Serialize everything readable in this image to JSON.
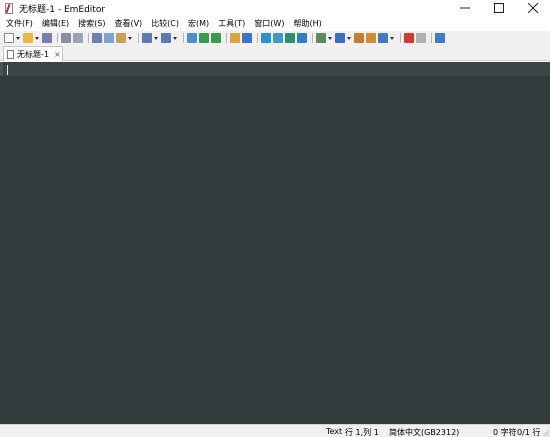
{
  "window": {
    "title": "无标题-1 - EmEditor",
    "minimize_icon": "minimize-icon",
    "maximize_icon": "maximize-icon",
    "close_icon": "close-icon"
  },
  "menu": {
    "items": [
      {
        "label": "文件(F)"
      },
      {
        "label": "编辑(E)"
      },
      {
        "label": "搜索(S)"
      },
      {
        "label": "查看(V)"
      },
      {
        "label": "比较(C)"
      },
      {
        "label": "宏(M)"
      },
      {
        "label": "工具(T)"
      },
      {
        "label": "窗口(W)"
      },
      {
        "label": "帮助(H)"
      }
    ]
  },
  "toolbar": {
    "buttons": [
      {
        "icon": "new-file-icon",
        "color": "#ffffff"
      },
      {
        "icon": "open-file-icon",
        "color": "#e8b73c"
      },
      {
        "icon": "save-icon",
        "color": "#7b7ea8"
      },
      {
        "icon": "print-icon",
        "color": "#8a8fa0"
      },
      {
        "icon": "print-preview-icon",
        "color": "#9aa4b8"
      },
      {
        "icon": "cut-icon",
        "color": "#6a7fb5"
      },
      {
        "icon": "copy-icon",
        "color": "#7fa0d4"
      },
      {
        "icon": "paste-icon",
        "color": "#c9a255"
      },
      {
        "icon": "undo-icon",
        "color": "#5c7ab8"
      },
      {
        "icon": "redo-icon",
        "color": "#5c7ab8"
      },
      {
        "icon": "find-icon",
        "color": "#4a8fd0"
      },
      {
        "icon": "find-next-icon",
        "color": "#3c9a4b"
      },
      {
        "icon": "find-previous-icon",
        "color": "#3c9a4b"
      },
      {
        "icon": "find-in-files-icon",
        "color": "#d9a53a"
      },
      {
        "icon": "format-icon",
        "color": "#3a73c9"
      },
      {
        "icon": "layout-icon",
        "color": "#2d8fd5"
      },
      {
        "icon": "split-horizontal-icon",
        "color": "#3d9acb"
      },
      {
        "icon": "split-vertical-icon",
        "color": "#2d8f6d"
      },
      {
        "icon": "outline-icon",
        "color": "#2f7fc2"
      },
      {
        "icon": "document-icon",
        "color": "#5b8c5a"
      },
      {
        "icon": "compare-icon",
        "color": "#3a6dc4"
      },
      {
        "icon": "settings-icon",
        "color": "#c87a2e"
      },
      {
        "icon": "edit-icon",
        "color": "#d28b2d"
      },
      {
        "icon": "window-icon",
        "color": "#3f7ac6"
      },
      {
        "icon": "record-macro-icon",
        "color": "#d33a2f"
      },
      {
        "icon": "run-macro-icon",
        "color": "#9a9a9a"
      },
      {
        "icon": "plugin-icon",
        "color": "#3f7ac6"
      }
    ]
  },
  "tabs": [
    {
      "label": "无标题-1",
      "close": "×"
    }
  ],
  "editor": {
    "background": "#323a3c",
    "current_line_background": "#3d4446",
    "caret_color": "#d7e3ff"
  },
  "status": {
    "mode": "Text",
    "position": "行 1,列 1",
    "encoding": "简体中文(GB2312)",
    "chars": "0 字符",
    "lines": "0/1 行"
  }
}
